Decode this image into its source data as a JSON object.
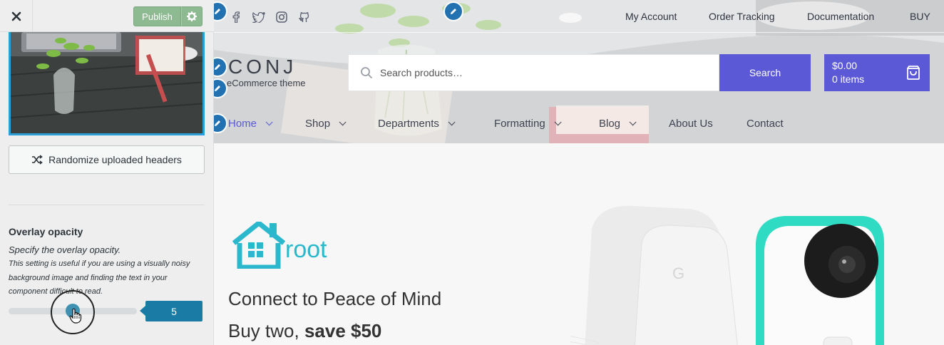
{
  "sidebar": {
    "close_label": "✕",
    "publish_label": "Publish",
    "randomize_label": "Randomize uploaded headers",
    "overlay": {
      "title": "Overlay opacity",
      "subtitle": "Specify the overlay opacity.",
      "description": "This setting is useful if you are using a visually noisy background image and finding the text in your component difficult to read.",
      "value": "5",
      "slider_fraction": 0.5
    }
  },
  "preview": {
    "top_nav": [
      "My Account",
      "Order Tracking",
      "Documentation",
      "BUY"
    ],
    "social_icons": [
      "facebook-icon",
      "twitter-icon",
      "instagram-icon",
      "github-icon"
    ],
    "logo": "CONJ",
    "tagline": "eCommerce theme",
    "search": {
      "placeholder": "Search products…",
      "button": "Search"
    },
    "cart": {
      "total": "$0.00",
      "items": "0 items"
    },
    "main_nav": [
      {
        "label": "Home",
        "dropdown": true,
        "active": true
      },
      {
        "label": "Shop",
        "dropdown": true
      },
      {
        "label": "Departments",
        "dropdown": true
      },
      {
        "label": "Formatting",
        "dropdown": true
      },
      {
        "label": "Blog",
        "dropdown": true
      },
      {
        "label": "About Us",
        "dropdown": false
      },
      {
        "label": "Contact",
        "dropdown": false
      }
    ],
    "promo": {
      "brand": "root",
      "headline": "Connect to Peace of Mind",
      "subline_prefix": "Buy two,",
      "subline_bold": "save $50"
    }
  },
  "colors": {
    "accent": "#5b59d5",
    "publish": "#8dba90",
    "customizer_blue": "#1a7ca5",
    "brand_teal": "#2bb7cc"
  }
}
